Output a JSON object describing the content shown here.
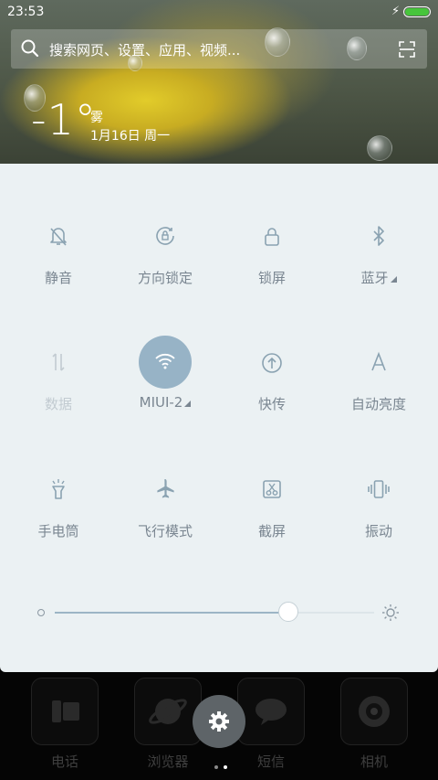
{
  "status_bar": {
    "time": "23:53",
    "battery_level": 1.0,
    "charging": true
  },
  "search": {
    "placeholder": "搜索网页、设置、应用、视频..."
  },
  "weather": {
    "temperature": "-1°",
    "condition": "雾",
    "date": "1月16日 周一"
  },
  "quick_settings": {
    "tiles": [
      {
        "label": "静音",
        "icon": "bell-mute-icon",
        "state": "off"
      },
      {
        "label": "方向锁定",
        "icon": "rotation-lock-icon",
        "state": "off"
      },
      {
        "label": "锁屏",
        "icon": "lock-icon",
        "state": "off"
      },
      {
        "label": "蓝牙",
        "icon": "bluetooth-icon",
        "state": "off"
      },
      {
        "label": "数据",
        "icon": "mobile-data-icon",
        "state": "disabled"
      },
      {
        "label": "MIUI-2",
        "icon": "wifi-icon",
        "state": "on"
      },
      {
        "label": "快传",
        "icon": "share-upload-icon",
        "state": "off"
      },
      {
        "label": "自动亮度",
        "icon": "auto-brightness-icon",
        "state": "off"
      },
      {
        "label": "手电筒",
        "icon": "flashlight-icon",
        "state": "off"
      },
      {
        "label": "飞行模式",
        "icon": "airplane-icon",
        "state": "off"
      },
      {
        "label": "截屏",
        "icon": "screenshot-icon",
        "state": "off"
      },
      {
        "label": "振动",
        "icon": "vibrate-icon",
        "state": "off"
      }
    ],
    "brightness": 0.73
  },
  "dock": {
    "apps": [
      {
        "label": "电话",
        "icon": "phone-icon"
      },
      {
        "label": "浏览器",
        "icon": "browser-icon"
      },
      {
        "label": "短信",
        "icon": "messages-icon"
      },
      {
        "label": "相机",
        "icon": "camera-icon"
      }
    ],
    "page_indicator": {
      "pages": 2,
      "current": 2
    }
  },
  "colors": {
    "panel_bg": "#ebf1f3",
    "accent": "#97b3c6",
    "battery": "#47c53c"
  }
}
